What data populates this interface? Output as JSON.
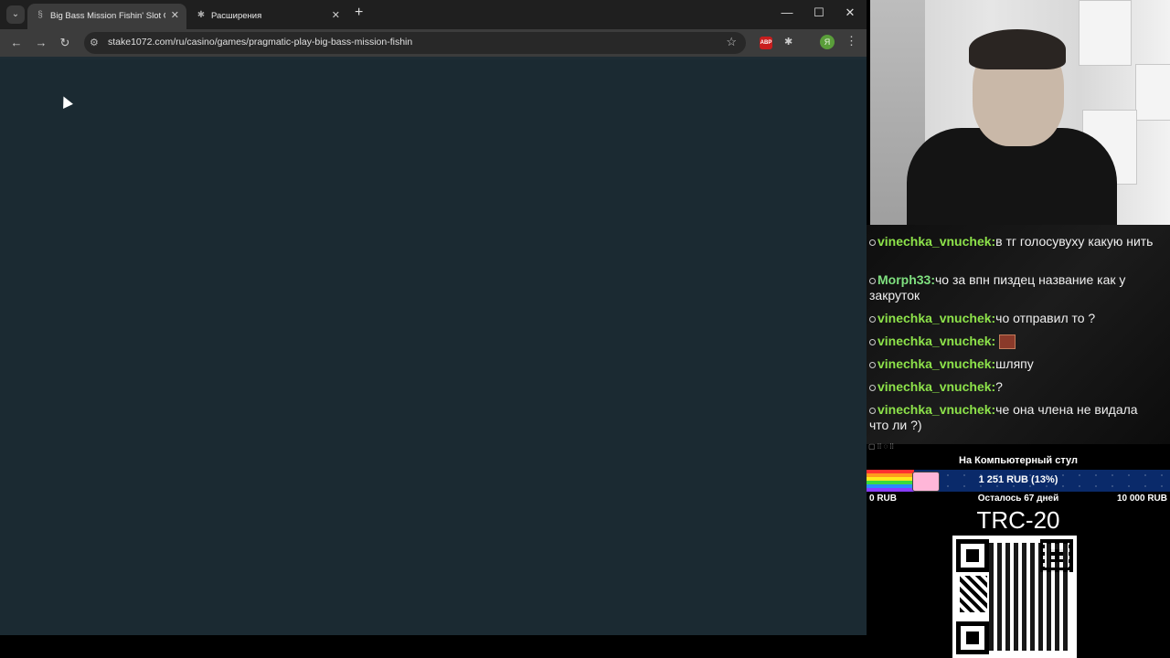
{
  "browser": {
    "tabs": [
      {
        "title": "Big Bass Mission Fishin' Slot Ga",
        "active": true,
        "icon": "stake-favicon"
      },
      {
        "title": "Расширения",
        "active": false,
        "icon": "puzzle-icon"
      }
    ],
    "url": "stake1072.com/ru/casino/games/pragmatic-play-big-bass-mission-fishin",
    "extension_abp_label": "ABP",
    "profile_initial": "Я"
  },
  "chat": {
    "messages": [
      {
        "user": "vinechka_vnuchek:",
        "text": "в тг голосувуху какую нить"
      },
      {
        "user": "Morph33:",
        "text": "чо за впн пиздец название как у закруток"
      },
      {
        "user": "vinechka_vnuchek:",
        "text": "чо отправил то ?"
      },
      {
        "user": "vinechka_vnuchek:",
        "text": "",
        "emote": true
      },
      {
        "user": "vinechka_vnuchek:",
        "text": "шляпу"
      },
      {
        "user": "vinechka_vnuchek:",
        "text": "?"
      },
      {
        "user": "vinechka_vnuchek:",
        "text": "че она члена не видала что ли ?)"
      }
    ]
  },
  "goal": {
    "title": "На Компьютерный стул",
    "progress_text": "1 251  RUB (13%)",
    "progress_fraction": 0.13,
    "min_label": "0 RUB",
    "remaining": "Осталось 67 дней",
    "max_label": "10 000 RUB"
  },
  "donation": {
    "network": "TRC-20"
  }
}
